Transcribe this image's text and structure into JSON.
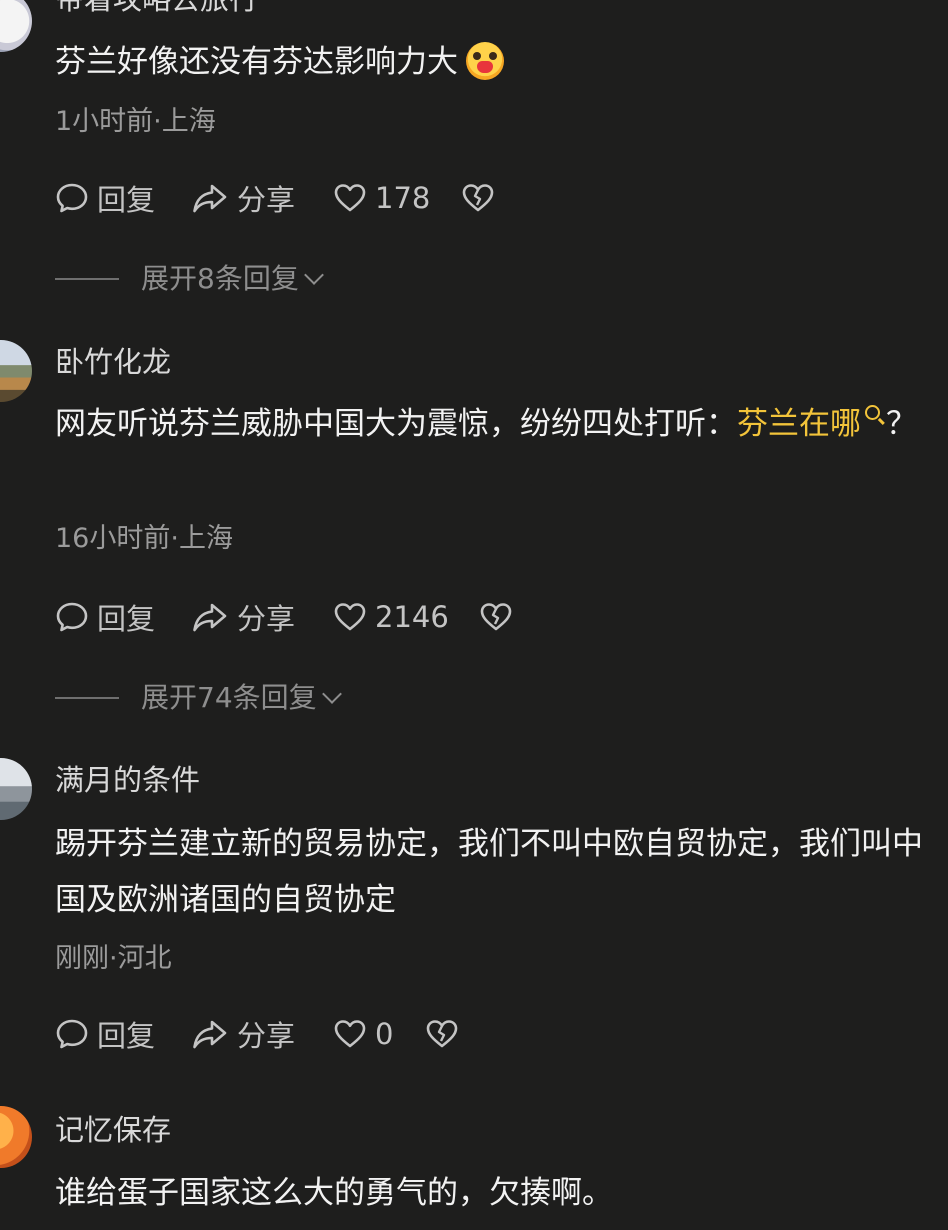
{
  "comments": [
    {
      "username": "带着攻略去旅行",
      "text": "芬兰好像还没有芬达影响力大",
      "meta": "1小时前·上海",
      "reply_label": "回复",
      "share_label": "分享",
      "likes": "178",
      "expand": "展开8条回复"
    },
    {
      "username": "卧竹化龙",
      "text_before": "网友听说芬兰威胁中国大为震惊，纷纷四处打听：",
      "text_link": "芬兰在哪",
      "text_after": "？",
      "meta": "16小时前·上海",
      "reply_label": "回复",
      "share_label": "分享",
      "likes": "2146",
      "expand": "展开74条回复"
    },
    {
      "username": "满月的条件",
      "text": "踢开芬兰建立新的贸易协定，我们不叫中欧自贸协定，我们叫中国及欧洲诸国的自贸协定",
      "meta": "刚刚·河北",
      "reply_label": "回复",
      "share_label": "分享",
      "likes": "0"
    },
    {
      "username": "记忆保存",
      "text": "谁给蛋子国家这么大的勇气的，欠揍啊。"
    }
  ],
  "colors": {
    "background": "#1e1e1d",
    "highlight": "#f3c43a",
    "meta": "#9b9b9b"
  },
  "icons": [
    "comment-icon",
    "share-icon",
    "heart-icon",
    "broken-heart-icon",
    "search-icon",
    "chevron-down-icon",
    "emoji-icon"
  ]
}
